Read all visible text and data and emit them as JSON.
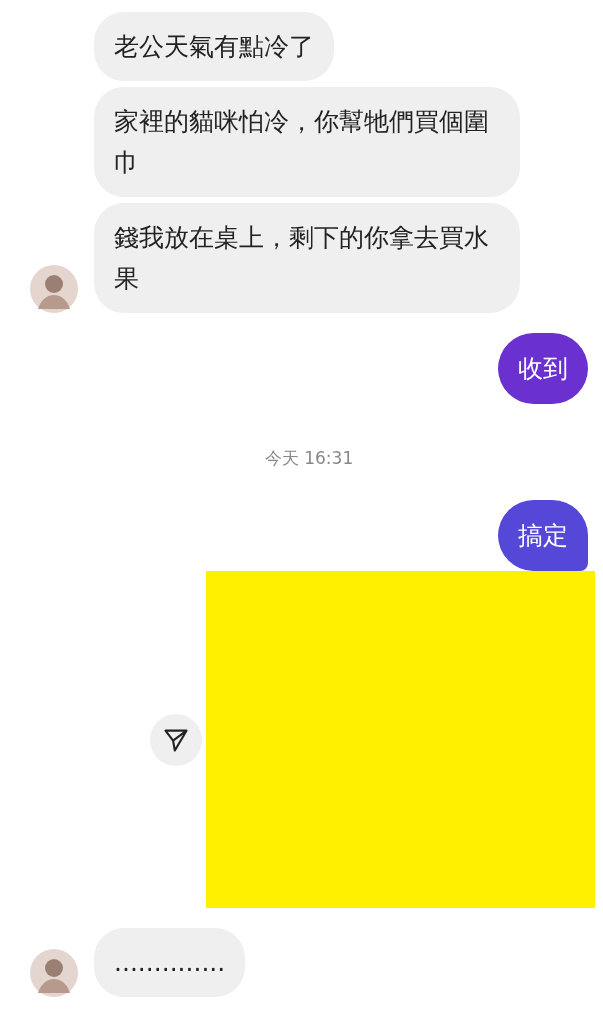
{
  "messages": [
    {
      "kind": "received",
      "text": "老公天氣有點冷了",
      "avatar": false
    },
    {
      "kind": "received",
      "text": "家裡的貓咪怕冷，你幫牠們買個圍巾",
      "avatar": false
    },
    {
      "kind": "received",
      "text": "錢我放在桌上，剩下的你拿去買水果",
      "avatar": true
    },
    {
      "kind": "sent",
      "text": "收到",
      "color": "#6a30d0"
    },
    {
      "kind": "time",
      "text": "今天 16:31"
    },
    {
      "kind": "sent",
      "text": "搞定",
      "color": "#5548d8"
    },
    {
      "kind": "image"
    },
    {
      "kind": "received",
      "text": "..............",
      "avatar": true
    }
  ]
}
